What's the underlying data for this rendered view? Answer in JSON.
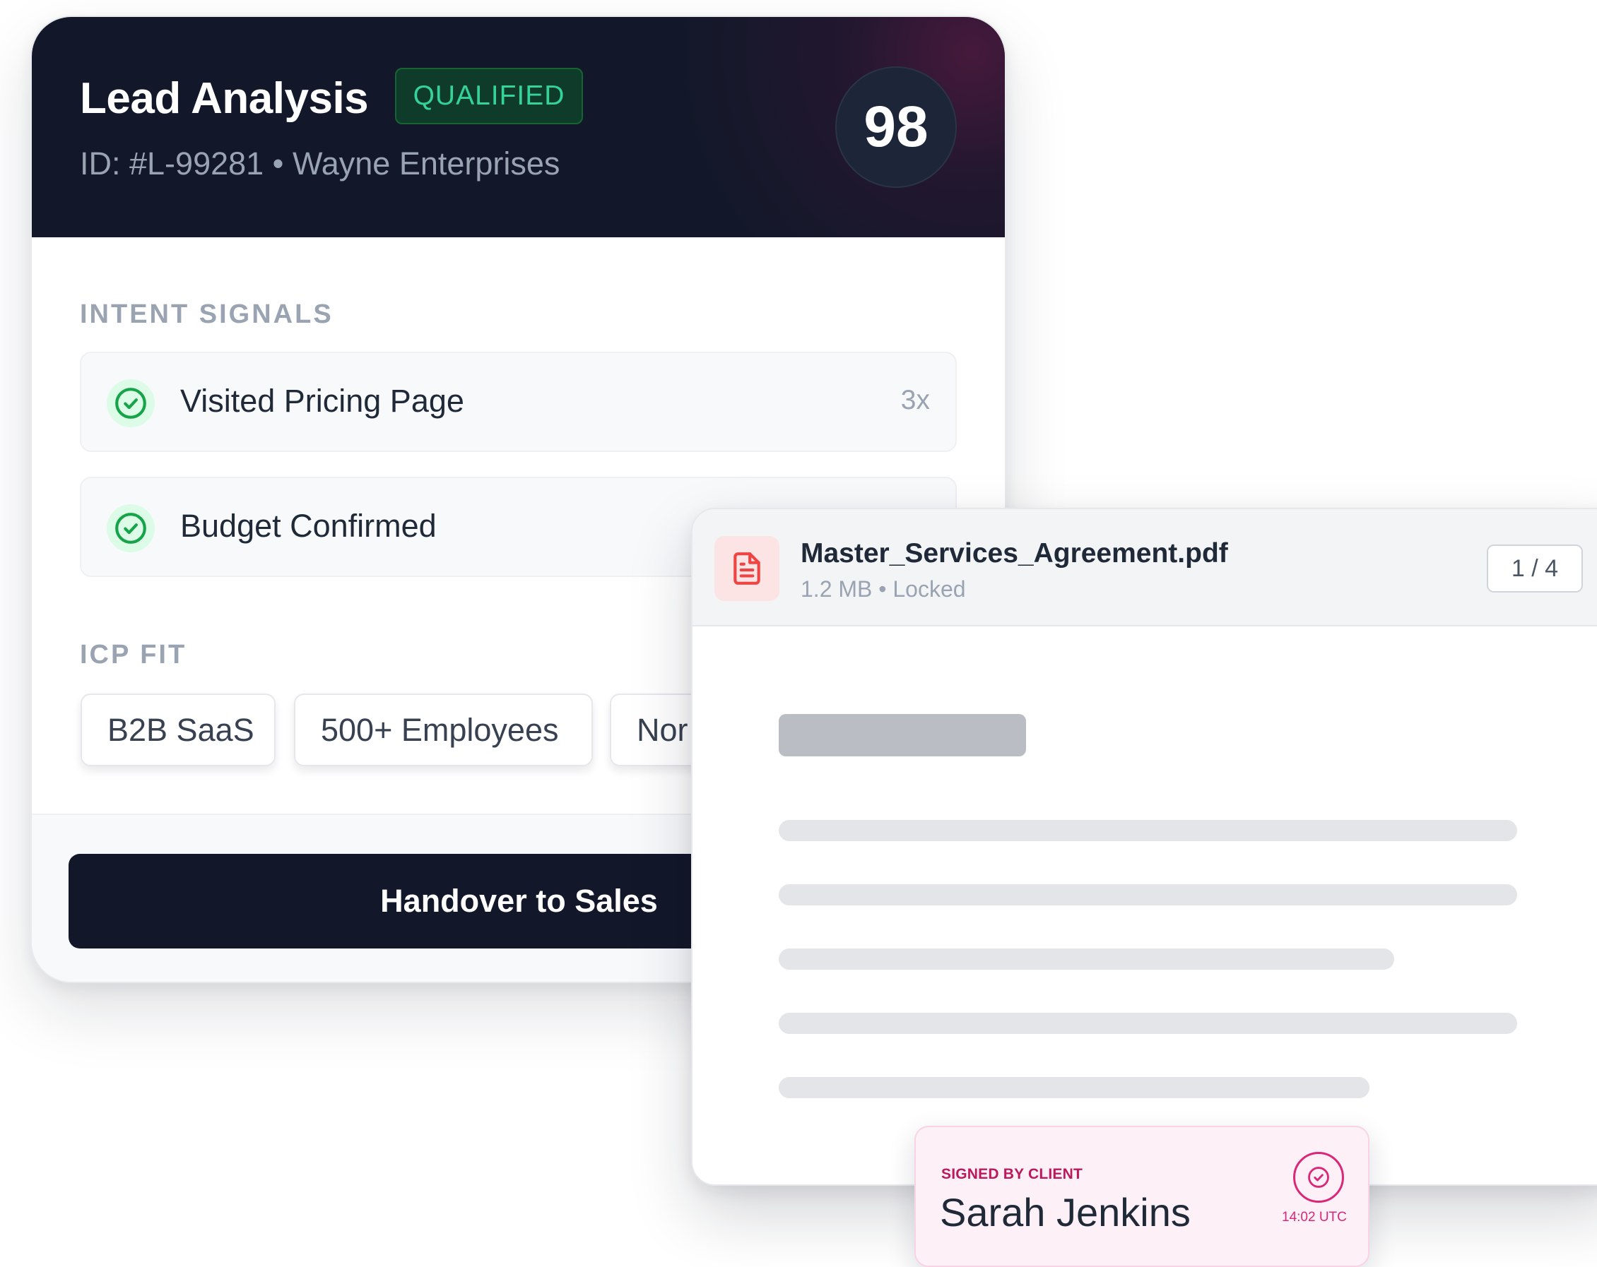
{
  "lead": {
    "title": "Lead Analysis",
    "status_badge": "QUALIFIED",
    "subtitle": "ID: #L-99281 • Wayne Enterprises",
    "score": "98",
    "intent_signals": {
      "heading": "INTENT SIGNALS",
      "items": [
        {
          "label": "Visited Pricing Page",
          "count": "3x",
          "icon": "check-circle-icon"
        },
        {
          "label": "Budget Confirmed",
          "count": "",
          "icon": "check-circle-icon"
        }
      ]
    },
    "icp_fit": {
      "heading": "ICP FIT",
      "tags": [
        "B2B SaaS",
        "500+ Employees",
        "Nor"
      ]
    },
    "handover_label": "Handover to Sales"
  },
  "document": {
    "file_name": "Master_Services_Agreement.pdf",
    "meta": "1.2 MB • Locked",
    "page_indicator": "1 / 4",
    "icon": "file-text-icon"
  },
  "signature": {
    "label": "SIGNED BY CLIENT",
    "name": "Sarah Jenkins",
    "time": "14:02 UTC",
    "icon": "check-circle-icon"
  },
  "colors": {
    "header_bg": "#121829",
    "accent_green": "#34d399",
    "accent_pink": "#db2777",
    "file_icon_red": "#ef4444"
  }
}
